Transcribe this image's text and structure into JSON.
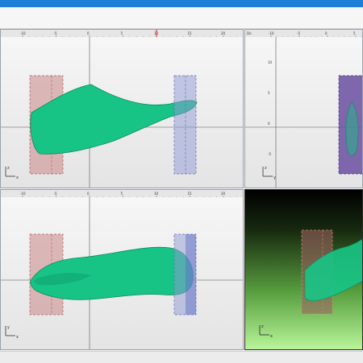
{
  "window": {
    "accent": "#1f7fd6"
  },
  "colors": {
    "shoe": "#17c486",
    "shoe_dark": "#0e8a5a",
    "box_red": "#c98787",
    "box_blue": "#8e9ad3",
    "box_purple": "#6a4fa0"
  },
  "top_ruler": {
    "ticks": [
      "-10",
      "-5",
      "0",
      "5",
      "10",
      "15",
      "20"
    ]
  },
  "right_ruler": {
    "corner": "Dir.",
    "ticks": [
      "-10",
      "-5",
      "0",
      "5"
    ],
    "side": [
      "10",
      "5",
      "0",
      "-5"
    ]
  },
  "bottom_ruler": {
    "ticks": [
      "-10",
      "-5",
      "0",
      "5",
      "10",
      "15",
      "20"
    ]
  },
  "axes": {
    "front": [
      "z",
      "x"
    ],
    "right": [
      "z",
      "y"
    ],
    "top": [
      "y",
      "x"
    ],
    "persp": [
      "z",
      "x"
    ]
  }
}
